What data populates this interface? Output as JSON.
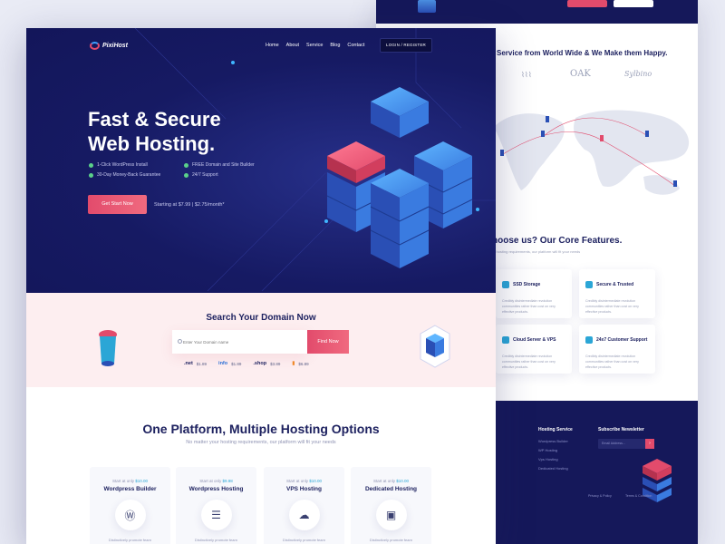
{
  "back": {
    "clients_title": "Service from World Wide & We Make them Happy.",
    "client_logos": [
      "OAK",
      "Sylbino"
    ],
    "features_title": "hoose us? Our Core Features.",
    "features_sub": "r hosting requirements, our platform will fit your needs",
    "features": [
      {
        "title": "SSD Storage",
        "icon": "ssd-icon",
        "desc": "Credibly disintermediate revolution communities rather than cost on very effective products."
      },
      {
        "title": "Secure & Trusted",
        "icon": "shield-icon",
        "desc": "Credibly disintermediate revolution communities rather than cost on very effective products."
      },
      {
        "title": "Cloud Server & VPS",
        "icon": "cloud-icon",
        "desc": "Credibly disintermediate revolution communities rather than cost on very effective products."
      },
      {
        "title": "24x7 Customer Support",
        "icon": "support-icon",
        "desc": "Credibly disintermediate revolution communities rather than cost on very effective products."
      }
    ],
    "footer": {
      "col1_title": "Hosting Service",
      "col1_links": [
        "Wordpress Builder",
        "WP Hosting",
        "Vps Hosting",
        "Dedicated Hosting"
      ],
      "col2_title": "Subscribe Newsletter",
      "email_placeholder": "Email Address...",
      "legal": [
        "Privacy & Policy",
        "Terms & Condition"
      ]
    }
  },
  "nav": {
    "brand": "PixiHost",
    "links": [
      "Home",
      "About",
      "Service",
      "Blog",
      "Contact"
    ],
    "login": "LOGIN / REGISTER"
  },
  "hero": {
    "title_line1": "Fast & Secure",
    "title_line2": "Web Hosting.",
    "features": [
      "1-Click WordPress Install",
      "FREE Domain and Site Builder",
      "30-Day Money-Back Guarantee",
      "24/7 Support"
    ],
    "cta": "Get Start Now",
    "price_note": "Starting at $7.99  | $2.75/month*"
  },
  "domain": {
    "title": "Search Your Domain Now",
    "placeholder": "Enter Your Domain name",
    "button": "Find Now",
    "tlds": [
      {
        "name": ".net",
        "price": "$1.89",
        "color": "#1e2260"
      },
      {
        "name": "info",
        "price": "$1.89",
        "color": "#2a6fd6"
      },
      {
        "name": ".shop",
        "price": "$3.89",
        "color": "#1e2260"
      },
      {
        "name": "▮",
        "price": "$6.89",
        "color": "#f08a2c"
      }
    ]
  },
  "hosting": {
    "title": "One Platform, Multiple Hosting Options",
    "subtitle": "No matter your hosting requirements, our platform will fit your needs",
    "cards": [
      {
        "start": "Start at only",
        "price": "$10.00",
        "name": "Wordpress Builder",
        "icon": "wordpress-icon",
        "desc": "Distinctively promote fearn"
      },
      {
        "start": "Start at only",
        "price": "$9.98",
        "name": "Wordpress Hosting",
        "icon": "server-stack-icon",
        "desc": "Distinctively promote fearn"
      },
      {
        "start": "Start at only",
        "price": "$10.00",
        "name": "VPS Hosting",
        "icon": "cloud-server-icon",
        "desc": "Distinctively promote fearn"
      },
      {
        "start": "Start at only",
        "price": "$10.00",
        "name": "Dedicated Hosting",
        "icon": "dedicated-server-icon",
        "desc": "Distinctively promote fearn"
      }
    ]
  },
  "colors": {
    "navy": "#161a63",
    "accent": "#e24b6c",
    "cyan": "#2ba6d6",
    "pink_bg": "#fdeef0"
  }
}
